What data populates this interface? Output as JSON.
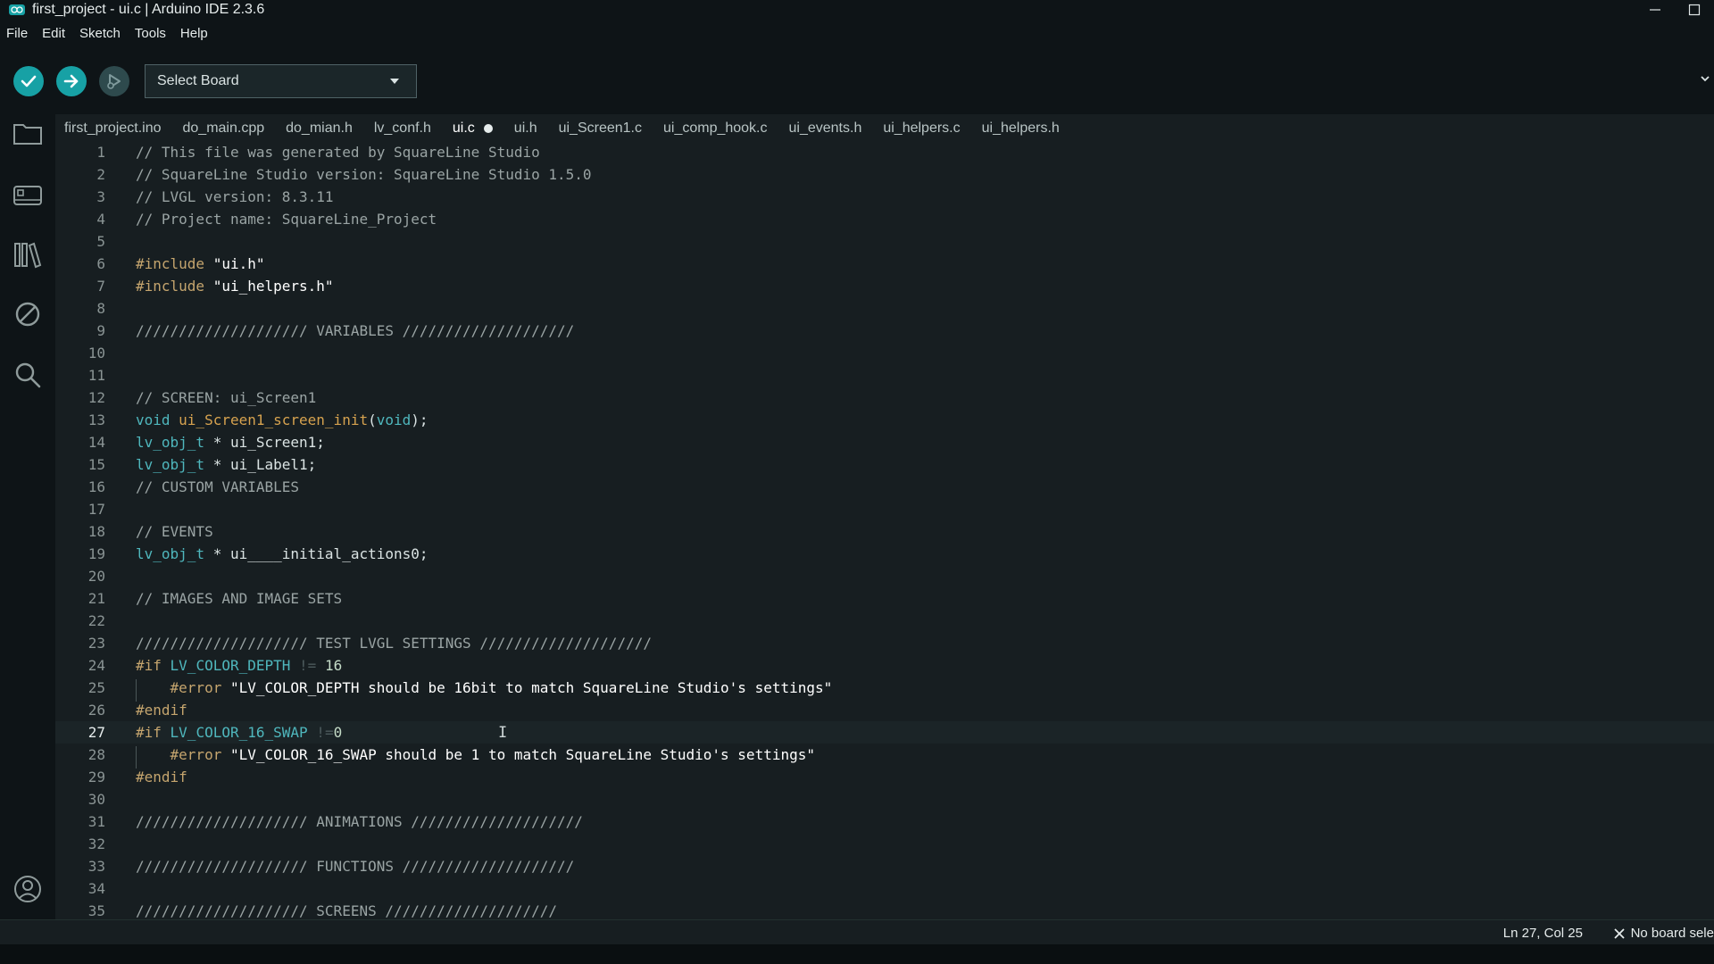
{
  "window": {
    "title": "first_project - ui.c | Arduino IDE 2.3.6",
    "minimize_glyph": "—",
    "maximize_glyph": "☐"
  },
  "menu": [
    "File",
    "Edit",
    "Sketch",
    "Tools",
    "Help"
  ],
  "toolbar": {
    "board_select": "Select Board"
  },
  "sidebar_icons": [
    "folder-icon",
    "boards-manager-icon",
    "library-icon",
    "debug-icon",
    "search-icon",
    "account-icon"
  ],
  "tabs": [
    {
      "label": "first_project.ino"
    },
    {
      "label": "do_main.cpp"
    },
    {
      "label": "do_mian.h"
    },
    {
      "label": "lv_conf.h"
    },
    {
      "label": "ui.c",
      "active": true,
      "modified": true
    },
    {
      "label": "ui.h"
    },
    {
      "label": "ui_Screen1.c"
    },
    {
      "label": "ui_comp_hook.c"
    },
    {
      "label": "ui_events.h"
    },
    {
      "label": "ui_helpers.c"
    },
    {
      "label": "ui_helpers.h"
    }
  ],
  "editor": {
    "current_line": 27,
    "lines": [
      "1",
      "2",
      "3",
      "4",
      "5",
      "6",
      "7",
      "8",
      "9",
      "10",
      "11",
      "12",
      "13",
      "14",
      "15",
      "16",
      "17",
      "18",
      "19",
      "20",
      "21",
      "22",
      "23",
      "24",
      "25",
      "26",
      "27",
      "28",
      "29",
      "30",
      "31",
      "32",
      "33",
      "34",
      "35"
    ],
    "code": {
      "l1": "// This file was generated by SquareLine Studio",
      "l2": "// SquareLine Studio version: SquareLine Studio 1.5.0",
      "l3": "// LVGL version: 8.3.11",
      "l4": "// Project name: SquareLine_Project",
      "l6_kw": "#include",
      "l6_str": " \"ui.h\"",
      "l7_kw": "#include",
      "l7_str": " \"ui_helpers.h\"",
      "l9": "//////////////////// VARIABLES ////////////////////",
      "l12": "// SCREEN: ui_Screen1",
      "l13_kw": "void",
      "l13_fn": " ui_Screen1_screen_init",
      "l13_p1": "(",
      "l13_ty": "void",
      "l13_p2": ");",
      "l14_ty": "lv_obj_t",
      "l14_rest": " * ui_Screen1;",
      "l15_ty": "lv_obj_t",
      "l15_rest": " * ui_Label1;",
      "l16": "// CUSTOM VARIABLES",
      "l18": "// EVENTS",
      "l19_ty": "lv_obj_t",
      "l19_rest": " * ui____initial_actions0;",
      "l21": "// IMAGES AND IMAGE SETS",
      "l23": "//////////////////// TEST LVGL SETTINGS ////////////////////",
      "l24_kw": "#if",
      "l24_mac": " LV_COLOR_DEPTH",
      "l24_op": " != ",
      "l24_num": "16",
      "l25_kw": "    #error",
      "l25_str": " \"LV_COLOR_DEPTH should be 16bit to match SquareLine Studio's settings\"",
      "l26": "#endif",
      "l27_kw": "#if",
      "l27_mac": " LV_COLOR_16_SWAP",
      "l27_op": " !=",
      "l27_num": "0",
      "l28_kw": "    #error",
      "l28_str": " \"LV_COLOR_16_SWAP should be 1 to match SquareLine Studio's settings\"",
      "l29": "#endif",
      "l31": "//////////////////// ANIMATIONS ////////////////////",
      "l33": "//////////////////// FUNCTIONS ////////////////////",
      "l35": "//////////////////// SCREENS ////////////////////"
    }
  },
  "status": {
    "position": "Ln 27, Col 25",
    "board_icon": "close-icon",
    "board": "No board sele"
  },
  "colors": {
    "accent": "#17a1a5",
    "background": "#171e21",
    "chrome": "#0e1417"
  }
}
